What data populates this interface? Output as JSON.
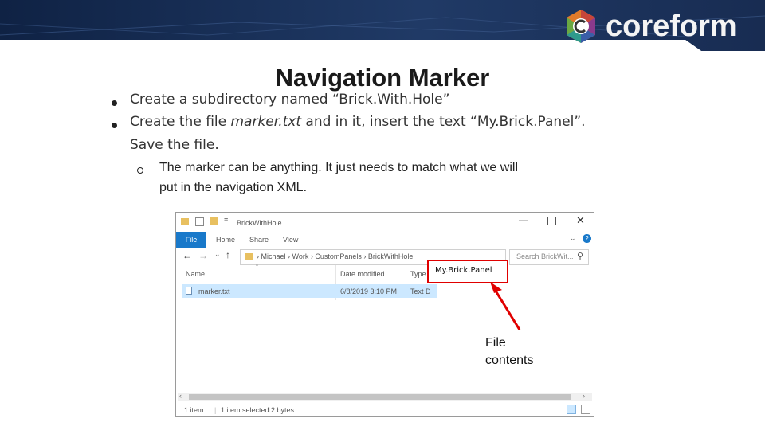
{
  "brand": {
    "logo_text": "coreform"
  },
  "slide": {
    "title": "Navigation Marker",
    "bullets": [
      {
        "parts": [
          "Create a subdirectory named “Brick.With.Hole”"
        ]
      },
      {
        "pre": "Create the file ",
        "em": "marker.txt",
        "post": " and in it, insert the text “My.Brick.Panel”.",
        "line2": "Save the file."
      }
    ],
    "sub_bullet": {
      "line1": "The marker can be anything. It just needs to match what we will",
      "line2": "put in the navigation XML."
    }
  },
  "explorer": {
    "window_title": "BrickWithHole",
    "ribbon_tabs": [
      "File",
      "Home",
      "Share",
      "View"
    ],
    "breadcrumb": [
      "Michael",
      "Work",
      "CustomPanels",
      "BrickWithHole"
    ],
    "search_placeholder": "Search BrickWit...",
    "columns": [
      "Name",
      "Date modified",
      "Type"
    ],
    "row": {
      "name": "marker.txt",
      "date": "6/8/2019 3:10 PM",
      "type": "Text D"
    },
    "status": {
      "count": "1 item",
      "selected": "1 item selected",
      "size": "12 bytes"
    }
  },
  "callout": {
    "file_text": "My.Brick.Panel",
    "label_line1": "File",
    "label_line2": "contents"
  },
  "colors": {
    "accent_red": "#e00000",
    "ribbon_blue": "#1979ca",
    "selection": "#cce8ff"
  }
}
